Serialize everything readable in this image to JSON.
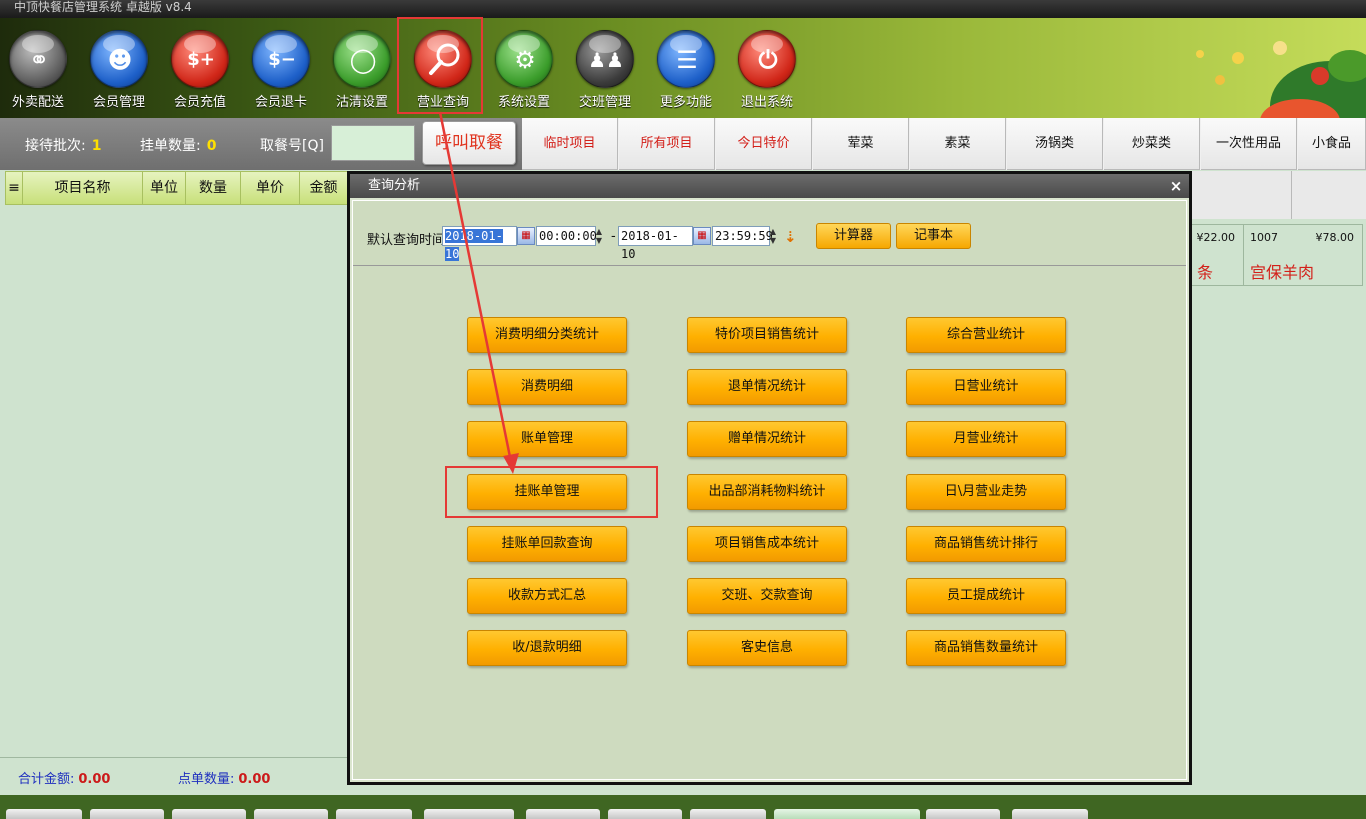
{
  "window": {
    "title": "中顶快餐店管理系统 卓越版 v8.4"
  },
  "toolbar": {
    "items": [
      {
        "label": "外卖配送",
        "icon": "scooter-icon"
      },
      {
        "label": "会员管理",
        "icon": "user-icon"
      },
      {
        "label": "会员充值",
        "icon": "card-plus-icon"
      },
      {
        "label": "会员退卡",
        "icon": "card-minus-icon"
      },
      {
        "label": "沽清设置",
        "icon": "plate-icon"
      },
      {
        "label": "营业查询",
        "icon": "search-icon"
      },
      {
        "label": "系统设置",
        "icon": "gear-icon"
      },
      {
        "label": "交班管理",
        "icon": "people-icon"
      },
      {
        "label": "更多功能",
        "icon": "list-icon"
      },
      {
        "label": "退出系统",
        "icon": "power-icon"
      }
    ]
  },
  "status": {
    "waiting_label": "接待批次:",
    "waiting_value": "1",
    "hold_label": "挂单数量:",
    "hold_value": "0",
    "ticket_label": "取餐号[Q]",
    "ticket_value": "",
    "call_button": "呼叫取餐"
  },
  "categories": [
    {
      "label": "临时项目",
      "color": "#d3201a"
    },
    {
      "label": "所有项目",
      "color": "#d3201a"
    },
    {
      "label": "今日特价",
      "color": "#d3201a"
    },
    {
      "label": "荤菜",
      "color": "#111111"
    },
    {
      "label": "素菜",
      "color": "#111111"
    },
    {
      "label": "汤锅类",
      "color": "#111111"
    },
    {
      "label": "炒菜类",
      "color": "#111111"
    },
    {
      "label": "一次性用品",
      "color": "#111111"
    },
    {
      "label": "小食品",
      "color": "#111111"
    }
  ],
  "order_grid": {
    "columns": [
      "项目名称",
      "单位",
      "数量",
      "单价",
      "金额"
    ]
  },
  "totals": {
    "total_label": "合计金额:",
    "total_value": "0.00",
    "count_label": "点单数量:",
    "count_value": "0.00"
  },
  "menu_items": [
    {
      "code": "",
      "price": "¥22.00",
      "name": "条"
    },
    {
      "code": "1007",
      "price": "¥78.00",
      "name": "宫保羊肉"
    }
  ],
  "dialog": {
    "title": "查询分析",
    "close": "×",
    "time_label": "默认查询时间",
    "start_date": "2018-01-10",
    "start_time": "00:00:00",
    "separator": "-",
    "end_date": "2018-01-10",
    "end_time": "23:59:59",
    "calculator": "计算器",
    "notepad": "记事本",
    "buttons": [
      [
        "消费明细分类统计",
        "特价项目销售统计",
        "综合营业统计"
      ],
      [
        "消费明细",
        "退单情况统计",
        "日营业统计"
      ],
      [
        "账单管理",
        "赠单情况统计",
        "月营业统计"
      ],
      [
        "挂账单管理",
        "出品部消耗物料统计",
        "日\\月营业走势"
      ],
      [
        "挂账单回款查询",
        "项目销售成本统计",
        "商品销售统计排行"
      ],
      [
        "收款方式汇总",
        "交班、交款查询",
        "员工提成统计"
      ],
      [
        "收/退款明细",
        "客史信息",
        "商品销售数量统计"
      ]
    ]
  },
  "colors": {
    "annotation": "#e53935",
    "button_orange": "#ffb000",
    "accent_red": "#d3201a"
  }
}
